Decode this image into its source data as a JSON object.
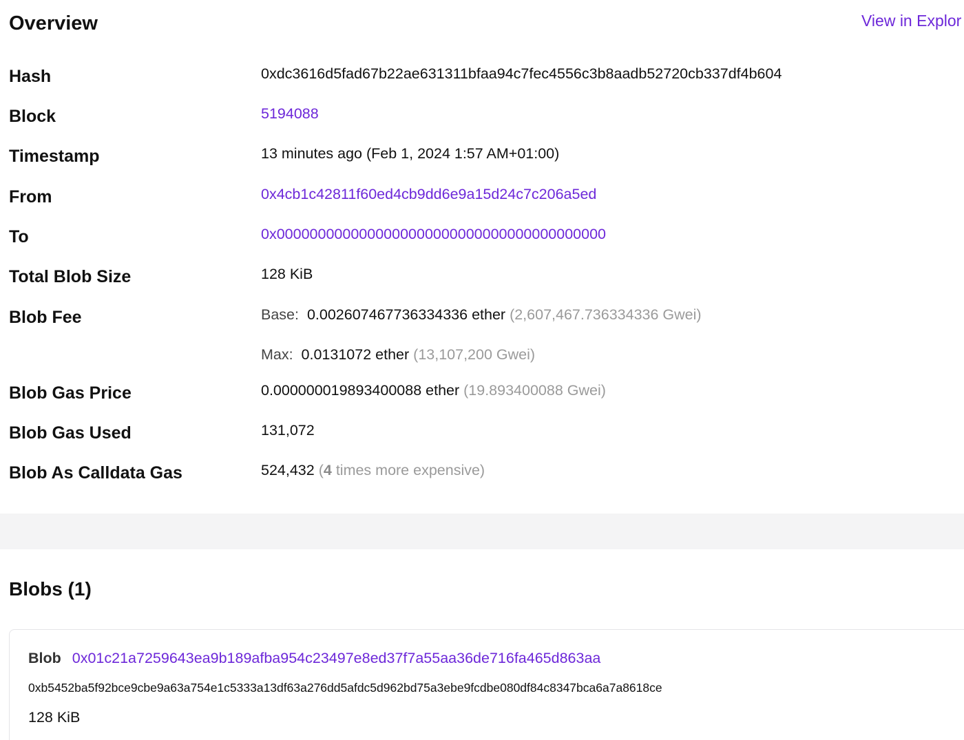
{
  "overview": {
    "title": "Overview",
    "explorer_link": "View in Explor"
  },
  "fields": {
    "hash": {
      "label": "Hash",
      "value": "0xdc3616d5fad67b22ae631311bfaa94c7fec4556c3b8aadb52720cb337df4b604"
    },
    "block": {
      "label": "Block",
      "value": "5194088"
    },
    "timestamp": {
      "label": "Timestamp",
      "value": "13 minutes ago (Feb 1, 2024 1:57 AM+01:00)"
    },
    "from": {
      "label": "From",
      "value": "0x4cb1c42811f60ed4cb9dd6e9a15d24c7c206a5ed"
    },
    "to": {
      "label": "To",
      "value": "0x0000000000000000000000000000000000000000"
    },
    "total_blob_size": {
      "label": "Total Blob Size",
      "value": "128 KiB"
    },
    "blob_fee": {
      "label": "Blob Fee",
      "base_label": "Base:",
      "base_value": "0.002607467736334336 ether",
      "base_gwei": "(2,607,467.736334336 Gwei)",
      "max_label": "Max:",
      "max_value": "0.0131072 ether",
      "max_gwei": "(13,107,200 Gwei)"
    },
    "blob_gas_price": {
      "label": "Blob Gas Price",
      "value": "0.000000019893400088 ether",
      "gwei": "(19.893400088 Gwei)"
    },
    "blob_gas_used": {
      "label": "Blob Gas Used",
      "value": "131,072"
    },
    "blob_as_calldata_gas": {
      "label": "Blob As Calldata Gas",
      "value": "524,432",
      "paren_open": "(",
      "multiplier": "4",
      "paren_text": " times more expensive)"
    }
  },
  "blobs": {
    "title": "Blobs (1)",
    "items": [
      {
        "label": "Blob",
        "versioned_hash": "0x01c21a7259643ea9b189afba954c23497e8ed37f7a55aa36de716fa465d863aa",
        "commitment": "0xb5452ba5f92bce9cbe9a63a754e1c5333a13df63a276dd5afdc5d962bd75a3ebe9fcdbe080df84c8347bca6a7a8618ce",
        "size": "128 KiB"
      }
    ]
  },
  "colors": {
    "link": "#6d28d9",
    "muted": "#9a9a9a",
    "band": "#f4f4f5"
  }
}
